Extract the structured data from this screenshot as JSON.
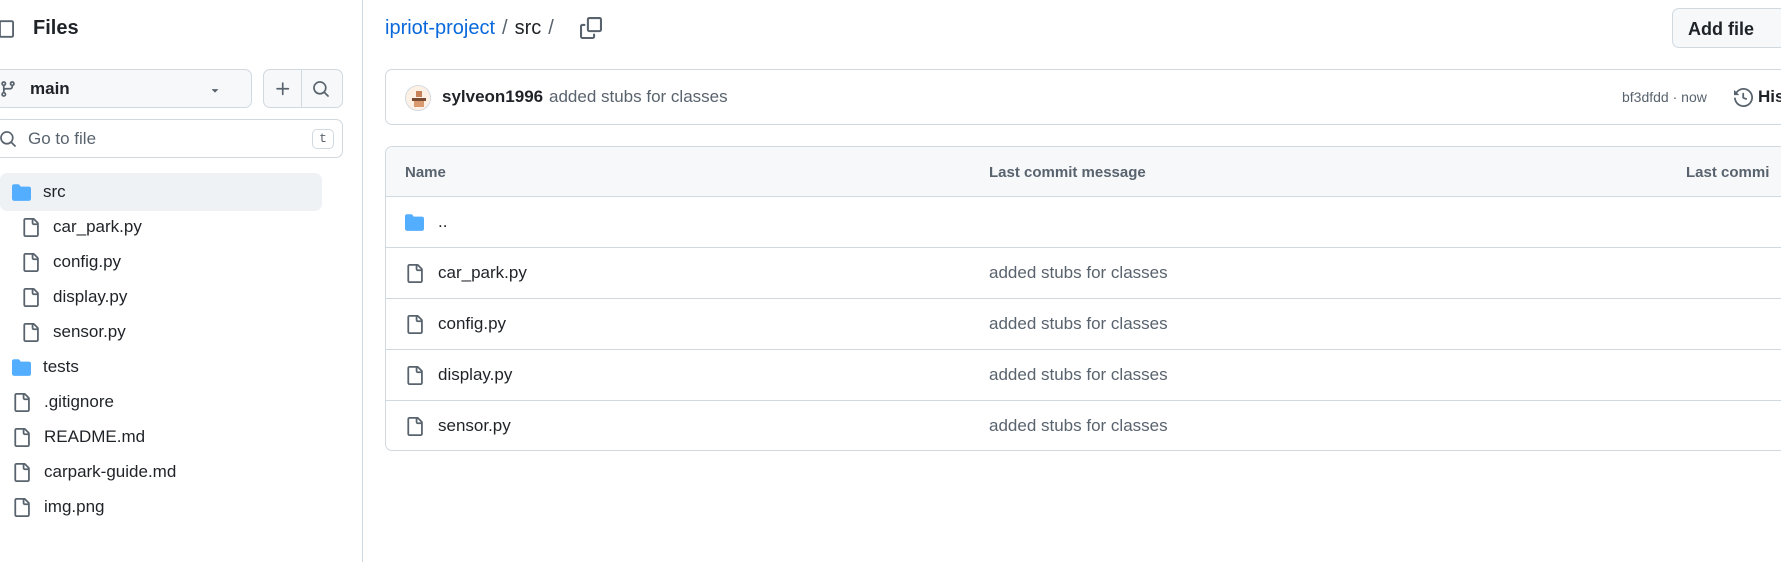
{
  "sidebar": {
    "title": "Files",
    "branch": "main",
    "goto_placeholder": "Go to file",
    "goto_shortcut": "t",
    "tree": [
      {
        "label": "src",
        "type": "folder",
        "depth": 0,
        "active": true
      },
      {
        "label": "car_park.py",
        "type": "file",
        "depth": 1
      },
      {
        "label": "config.py",
        "type": "file",
        "depth": 1
      },
      {
        "label": "display.py",
        "type": "file",
        "depth": 1
      },
      {
        "label": "sensor.py",
        "type": "file",
        "depth": 1
      },
      {
        "label": "tests",
        "type": "folder",
        "depth": 0
      },
      {
        "label": ".gitignore",
        "type": "file",
        "depth": 0
      },
      {
        "label": "README.md",
        "type": "file",
        "depth": 0
      },
      {
        "label": "carpark-guide.md",
        "type": "file",
        "depth": 0
      },
      {
        "label": "img.png",
        "type": "file",
        "depth": 0
      }
    ]
  },
  "breadcrumb": {
    "repo": "ipriot-project",
    "sep1": "/",
    "current": "src",
    "sep2": "/"
  },
  "toolbar": {
    "add_file_label": "Add file"
  },
  "commit": {
    "author": "sylveon1996",
    "message": "added stubs for classes",
    "sha_time": "bf3dfdd · now",
    "history_label": "His"
  },
  "table": {
    "headers": {
      "name": "Name",
      "message": "Last commit message",
      "date": "Last commi"
    },
    "rows": [
      {
        "name": "..",
        "type": "folder",
        "message": ""
      },
      {
        "name": "car_park.py",
        "type": "file",
        "message": "added stubs for classes"
      },
      {
        "name": "config.py",
        "type": "file",
        "message": "added stubs for classes"
      },
      {
        "name": "display.py",
        "type": "file",
        "message": "added stubs for classes"
      },
      {
        "name": "sensor.py",
        "type": "file",
        "message": "added stubs for classes"
      }
    ]
  },
  "colors": {
    "link": "#0969da",
    "folder": "#54aeff",
    "muted": "#59636e",
    "border": "#d1d9e0"
  },
  "icons": {
    "folder": "folder-icon",
    "file": "file-icon"
  }
}
